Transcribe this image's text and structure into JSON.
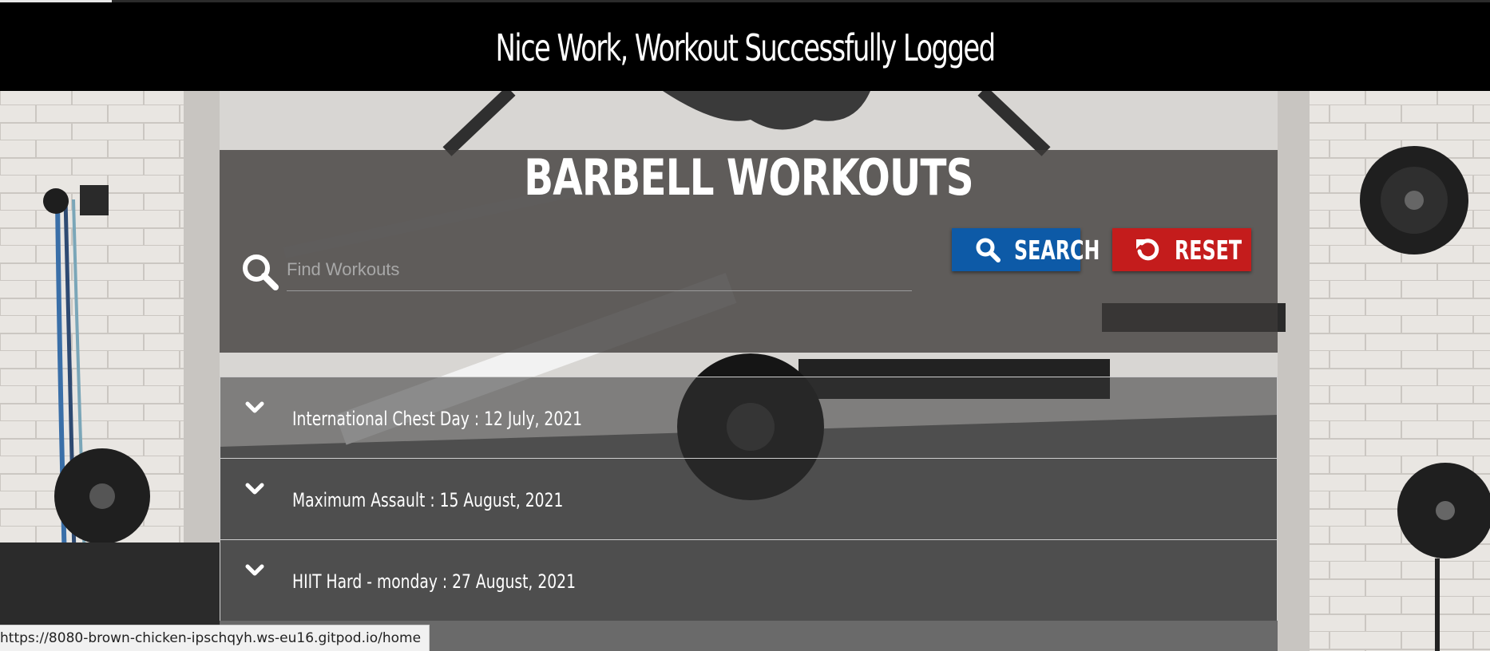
{
  "flash": {
    "message": "Nice Work, Workout Successfully Logged"
  },
  "panel": {
    "title": "BARBELL WORKOUTS",
    "search": {
      "placeholder": "Find Workouts",
      "value": ""
    },
    "buttons": {
      "search_label": "SEARCH",
      "reset_label": "RESET"
    }
  },
  "workouts": [
    {
      "label": "International Chest Day : 12 July, 2021"
    },
    {
      "label": "Maximum Assault : 15 August, 2021"
    },
    {
      "label": "HIIT Hard - monday : 27 August, 2021"
    }
  ],
  "status_bar": {
    "url": "https://8080-brown-chicken-ipschqyh.ws-eu16.gitpod.io/home"
  },
  "colors": {
    "search_button": "#0d5aa7",
    "reset_button": "#c41c1c",
    "header_bg": "#000000"
  },
  "icons": {
    "search": "search-icon",
    "reset": "undo-icon",
    "expand": "chevron-down-icon"
  }
}
